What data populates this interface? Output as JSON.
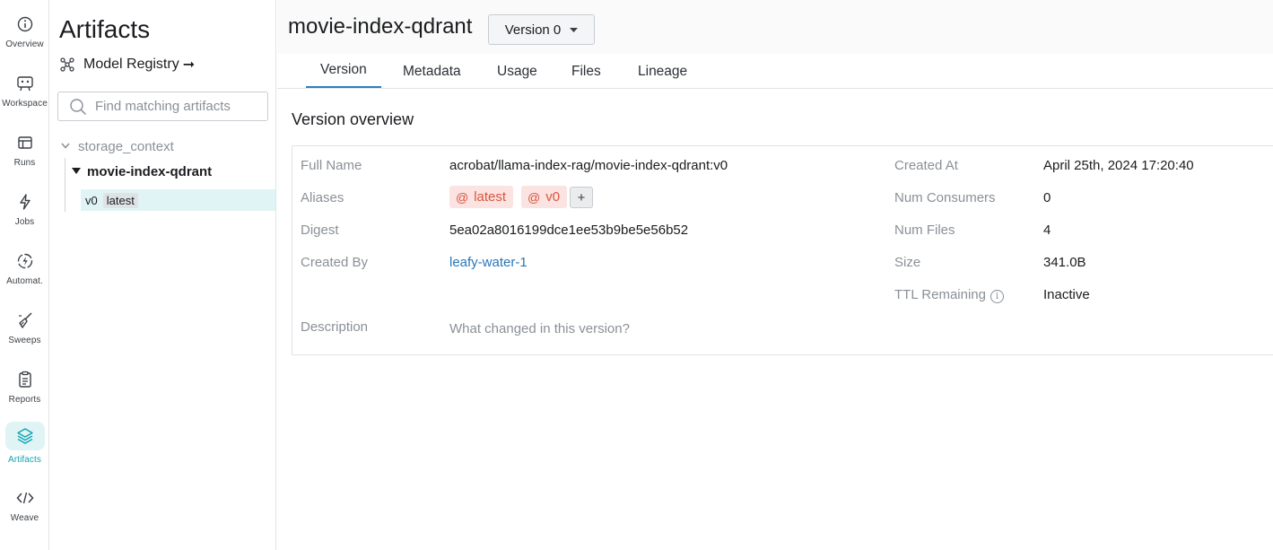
{
  "rail": {
    "items": [
      {
        "label": "Overview",
        "icon": "info-circle-icon"
      },
      {
        "label": "Workspace",
        "icon": "workspace-icon"
      },
      {
        "label": "Runs",
        "icon": "table-icon"
      },
      {
        "label": "Jobs",
        "icon": "lightning-icon"
      },
      {
        "label": "Automat.",
        "icon": "automation-icon"
      },
      {
        "label": "Sweeps",
        "icon": "broom-icon"
      },
      {
        "label": "Reports",
        "icon": "clipboard-icon"
      },
      {
        "label": "Artifacts",
        "icon": "layers-icon",
        "active": true
      },
      {
        "label": "Weave",
        "icon": "code-icon"
      }
    ],
    "active_color": "#10a4b0"
  },
  "sidebar": {
    "title": "Artifacts",
    "registry_link": "Model Registry",
    "registry_arrow": "➞",
    "search_placeholder": "Find matching artifacts",
    "tree": {
      "type_name": "storage_context",
      "collection_name": "movie-index-qdrant",
      "version": "v0",
      "version_tag": "latest"
    }
  },
  "header": {
    "artifact_name": "movie-index-qdrant",
    "version_dropdown": "Version 0"
  },
  "tabs": [
    "Version",
    "Metadata",
    "Usage",
    "Files",
    "Lineage"
  ],
  "active_tab": "Version",
  "overview": {
    "title": "Version overview",
    "full_name_label": "Full Name",
    "full_name": "acrobat/llama-index-rag/movie-index-qdrant:v0",
    "aliases_label": "Aliases",
    "aliases": [
      "latest",
      "v0"
    ],
    "add_alias": "+",
    "digest_label": "Digest",
    "digest": "5ea02a8016199dce1ee53b9be5e56b52",
    "created_by_label": "Created By",
    "created_by": "leafy-water-1",
    "description_label": "Description",
    "description_placeholder": "What changed in this version?",
    "created_at_label": "Created At",
    "created_at": "April 25th, 2024 17:20:40",
    "num_consumers_label": "Num Consumers",
    "num_consumers": "0",
    "num_files_label": "Num Files",
    "num_files": "4",
    "size_label": "Size",
    "size": "341.0B",
    "ttl_label": "TTL Remaining",
    "ttl": "Inactive"
  },
  "colors": {
    "accent": "#10a4b0",
    "link": "#2a76b8",
    "alias_bg": "#fbe3e1",
    "alias_text": "#d8563f",
    "tab_underline": "#2a80c5"
  }
}
